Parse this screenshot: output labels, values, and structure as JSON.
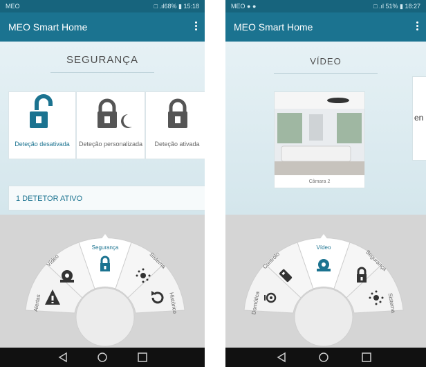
{
  "screen1": {
    "status": {
      "left": "MEO",
      "right": "□ .ıl68% ▮ 15:18"
    },
    "appbar": {
      "title": "MEO Smart Home"
    },
    "section_title": "SEGURANÇA",
    "cards": [
      {
        "label": "Deteção desativada",
        "icon": "lock-open-icon",
        "active": true
      },
      {
        "label": "Deteção personalizada",
        "icon": "lock-moon-icon",
        "active": false
      },
      {
        "label": "Deteção ativada",
        "icon": "lock-closed-icon",
        "active": false
      }
    ],
    "detector": "1 DETETOR ATIVO",
    "wheel": [
      {
        "label": "Alertas",
        "icon": "alert-icon"
      },
      {
        "label": "Vídeo",
        "icon": "camera-icon"
      },
      {
        "label": "Segurança",
        "icon": "lock-icon",
        "selected": true
      },
      {
        "label": "Sistema",
        "icon": "sun-icon"
      },
      {
        "label": "Histórico",
        "icon": "history-icon"
      }
    ]
  },
  "screen2": {
    "status": {
      "left": "MEO ● ●",
      "right": "□ .ıl 51% ▮ 18:27"
    },
    "appbar": {
      "title": "MEO Smart Home"
    },
    "section_title": "VÍDEO",
    "camera_label": "Câmara 2",
    "peek_text": "en",
    "wheel": [
      {
        "label": "Domótica",
        "icon": "device-icon"
      },
      {
        "label": "Controlo",
        "icon": "remote-icon"
      },
      {
        "label": "Vídeo",
        "icon": "camera-icon",
        "selected": true
      },
      {
        "label": "Segurança",
        "icon": "lock-icon"
      },
      {
        "label": "Sistema",
        "icon": "sun-icon"
      }
    ]
  },
  "colors": {
    "accent": "#1b7390",
    "statusbar": "#17647d",
    "dock": "#d5d5d5"
  }
}
